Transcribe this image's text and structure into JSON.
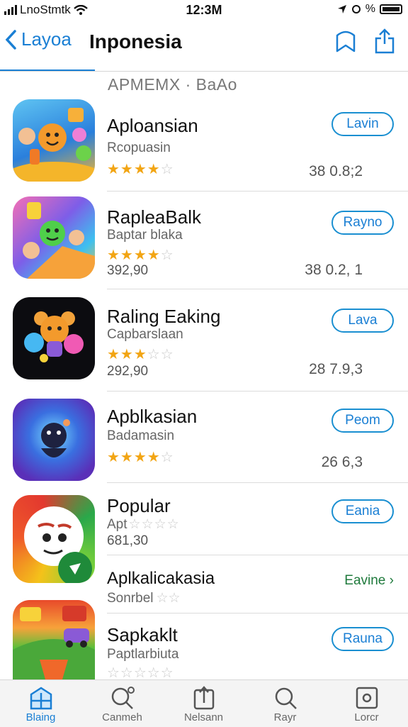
{
  "status": {
    "carrier": "LnoStmtk",
    "time": "12:3M",
    "percent": "%"
  },
  "nav": {
    "back_label": "Layoa",
    "title": "Inponesia"
  },
  "section_header": "APMEMX · BaAo",
  "apps": [
    {
      "title": "Aploansian",
      "subtitle": "Rcopuasin",
      "rating": 4.5,
      "meta": "",
      "number": "38 0.8;2",
      "button": "Lavin"
    },
    {
      "title": "RapleaBalk",
      "subtitle": "Baptar blaka",
      "rating": 4.5,
      "meta": "392,90",
      "number": "38 0.2, 1",
      "button": "Rayno"
    },
    {
      "title": "Raling Eaking",
      "subtitle": "Capbarslaan",
      "rating": 3.5,
      "meta": "292,90",
      "number": "28 7.9,3",
      "button": "Lava"
    },
    {
      "title": "Apblkasian",
      "subtitle": "Badamasin",
      "rating": 4.5,
      "meta": "",
      "number": "26 6,3",
      "button": "Peom"
    },
    {
      "title": "Popular",
      "subtitle": "Apt",
      "rating": 0,
      "meta": "681,30",
      "number": "",
      "button": "Eania"
    },
    {
      "title": "Aplkalicakasia",
      "subtitle": "Sonrbel",
      "rating": 0,
      "meta": "",
      "number": "",
      "button": "Eavine"
    },
    {
      "title": "Sapkaklt",
      "subtitle": "Paptlarbiuta",
      "rating": 0,
      "meta": "",
      "number": "",
      "button": "Rauna"
    }
  ],
  "tabs": [
    "Blaing",
    "Canmeh",
    "Nelsann",
    "Rayr",
    "Lorcr"
  ],
  "colors": {
    "accent": "#1a7fd4",
    "star": "#f2a514",
    "link_green": "#1f7a3c"
  }
}
